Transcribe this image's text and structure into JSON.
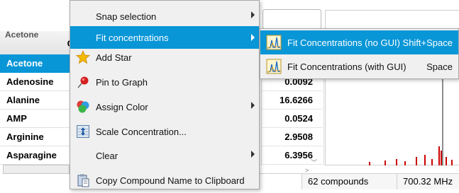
{
  "table": {
    "column_header": "Co",
    "clipped_row": "Acetone",
    "rows": [
      {
        "name": "Acetone",
        "value": ""
      },
      {
        "name": "Adenosine",
        "value": "0.0092"
      },
      {
        "name": "Alanine",
        "value": "16.6266"
      },
      {
        "name": "AMP",
        "value": "0.0524"
      },
      {
        "name": "Arginine",
        "value": "2.9508"
      },
      {
        "name": "Asparagine",
        "value": "6.3956"
      }
    ]
  },
  "context_menu": {
    "items": [
      {
        "label": "Snap selection",
        "icon": "",
        "submenu": true
      },
      {
        "label": "Fit concentrations",
        "icon": "",
        "submenu": true
      },
      {
        "label": "Add Star",
        "icon": "star-icon",
        "submenu": false
      },
      {
        "label": "Pin to Graph",
        "icon": "pushpin-icon",
        "submenu": false
      },
      {
        "label": "Assign Color",
        "icon": "color-balls-icon",
        "submenu": true
      },
      {
        "label": "Scale Concentration...",
        "icon": "scale-icon",
        "submenu": false
      },
      {
        "label": "Clear",
        "icon": "",
        "submenu": true
      },
      {
        "label": "Copy Compound Name to Clipboard",
        "icon": "clipboard-icon",
        "submenu": false
      }
    ]
  },
  "submenu": {
    "items": [
      {
        "label": "Fit Concentrations (no GUI)",
        "shortcut": "Shift+Space",
        "icon": "fit-spectrum-icon"
      },
      {
        "label": "Fit Concentrations (with GUI)",
        "shortcut": "Space",
        "icon": "fit-spectrum-icon"
      }
    ]
  },
  "status": {
    "compounds": "62 compounds",
    "frequency": "700.32 MHz"
  },
  "colors": {
    "accent": "#0896d7",
    "spectrum": "#cc0000"
  }
}
